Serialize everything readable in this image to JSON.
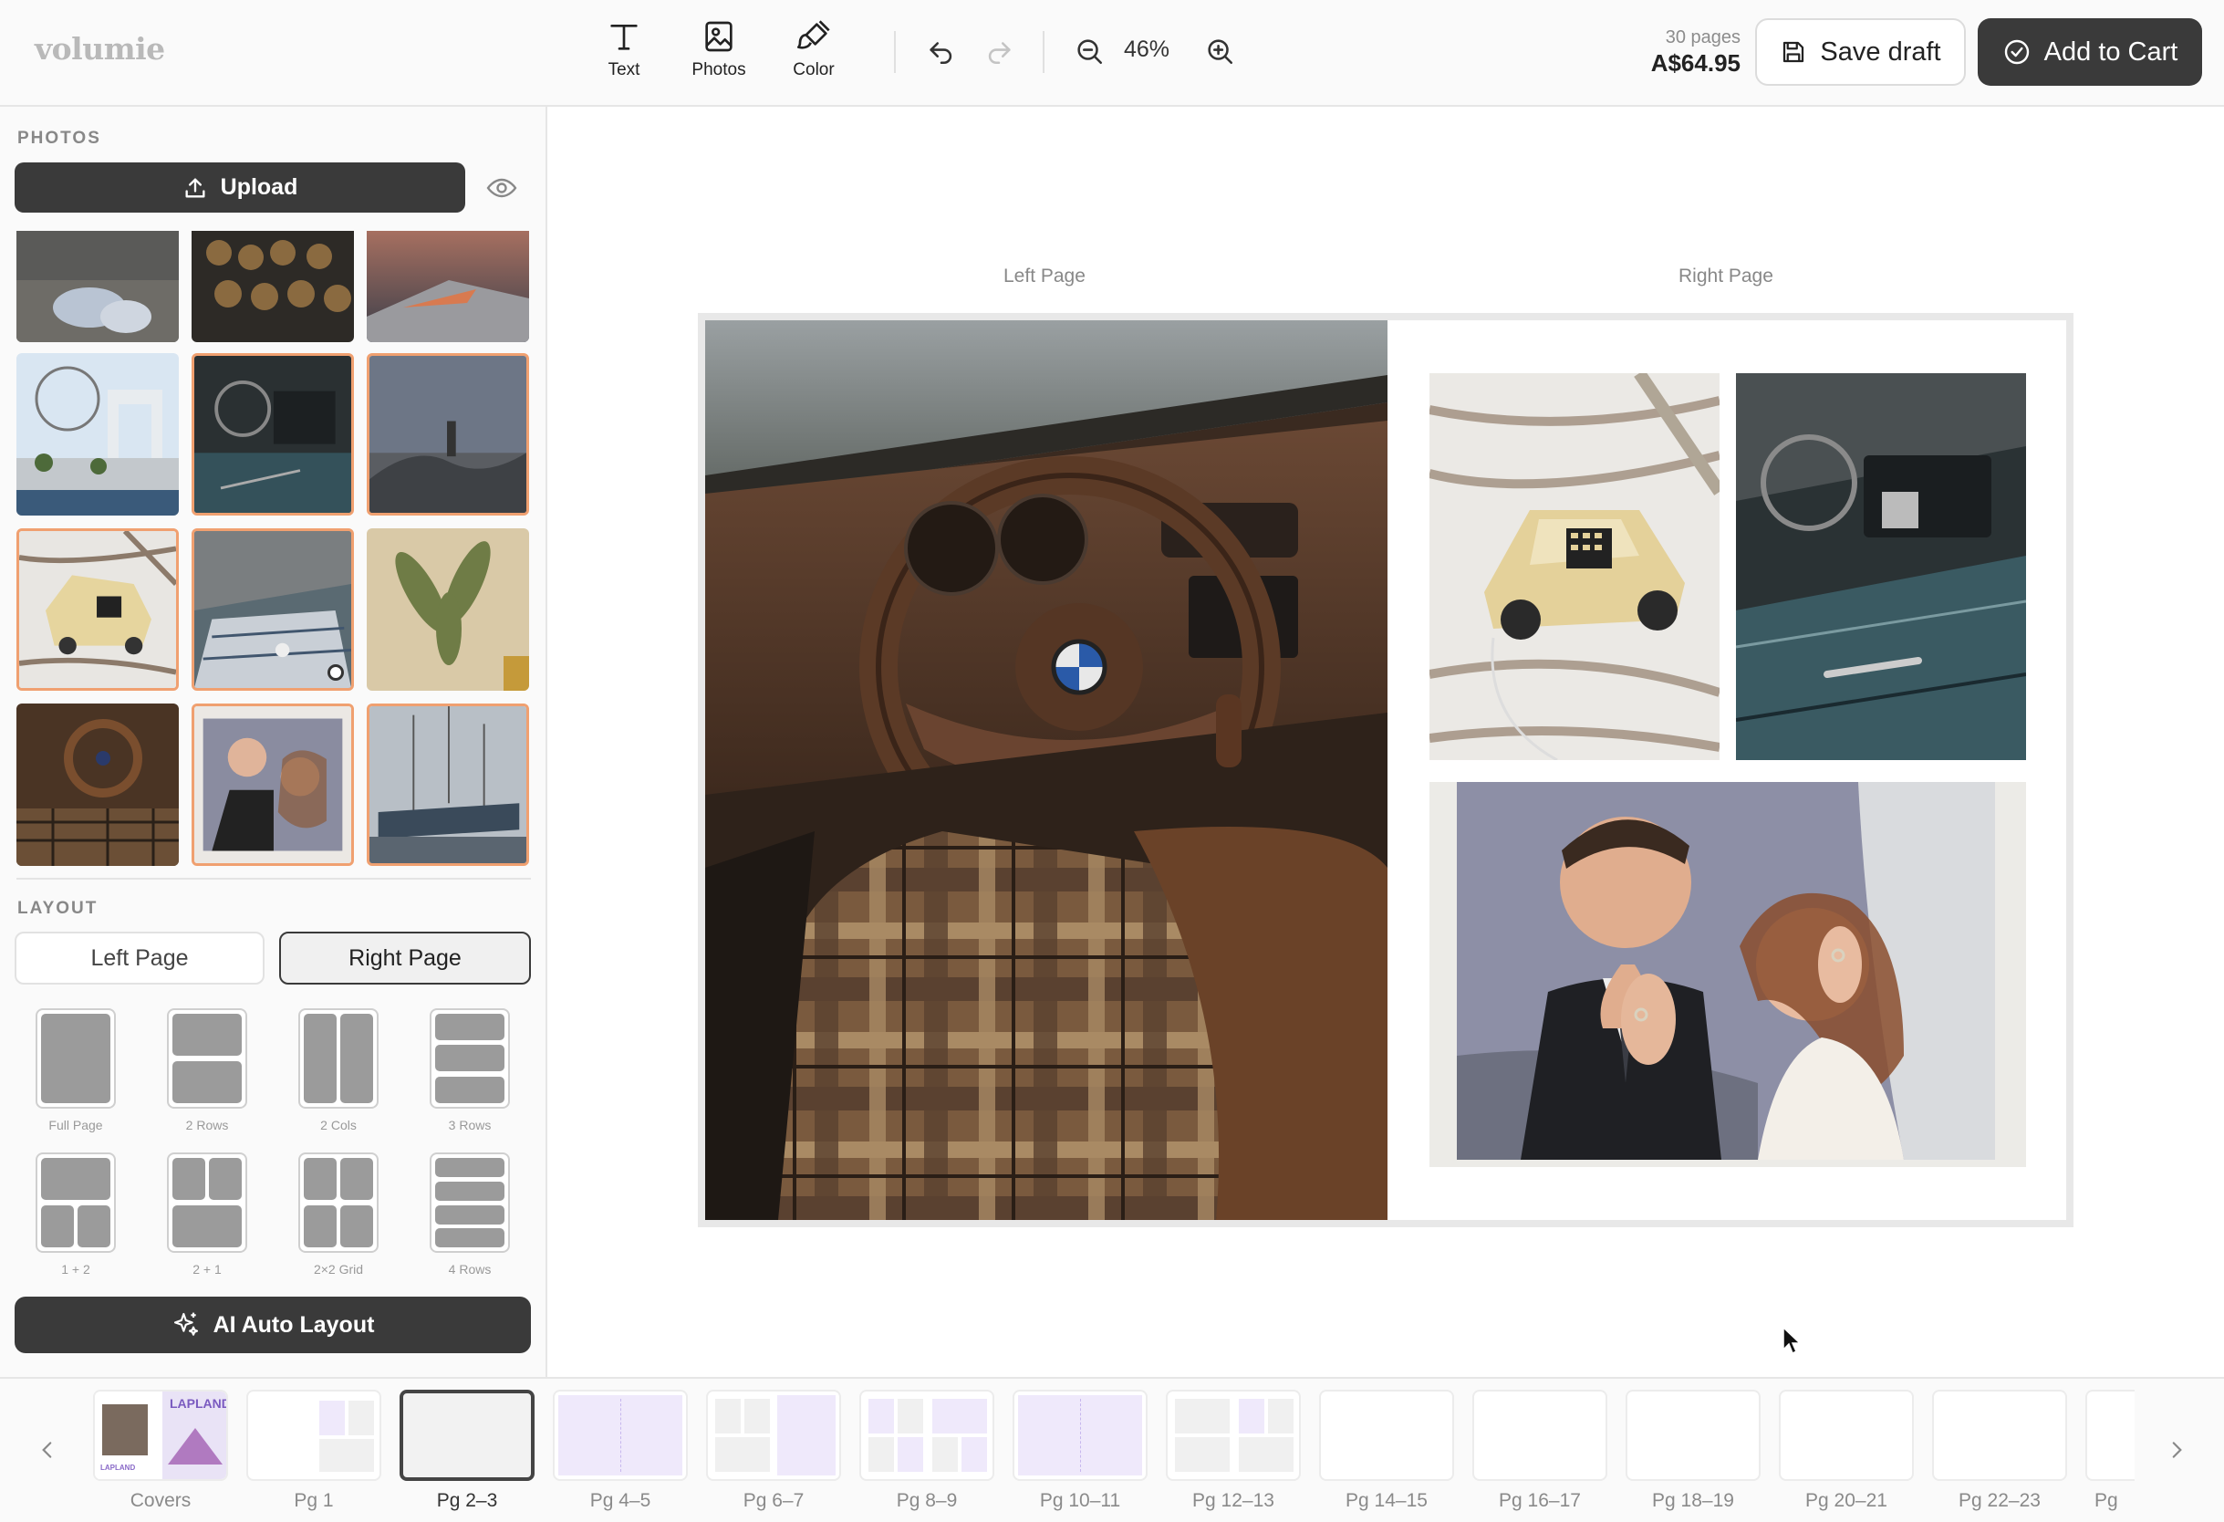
{
  "app": {
    "logo": "volumie"
  },
  "toolbar": {
    "text_label": "Text",
    "photos_label": "Photos",
    "color_label": "Color",
    "zoom": "46%",
    "pages_count": "30 pages",
    "price": "A$64.95",
    "save_label": "Save draft",
    "cart_label": "Add to Cart"
  },
  "sidebar": {
    "photos_title": "PHOTOS",
    "upload_label": "Upload",
    "layout_title": "LAYOUT",
    "left_page_label": "Left Page",
    "right_page_label": "Right Page",
    "selected_page": "Right Page",
    "layouts": [
      {
        "label": "Full Page"
      },
      {
        "label": "2 Rows"
      },
      {
        "label": "2 Cols"
      },
      {
        "label": "3 Rows"
      },
      {
        "label": "1 + 2"
      },
      {
        "label": "2 + 1"
      },
      {
        "label": "2×2 Grid"
      },
      {
        "label": "4 Rows"
      }
    ],
    "ai_label": "AI Auto Layout"
  },
  "canvas": {
    "left_page_label": "Left Page",
    "right_page_label": "Right Page"
  },
  "filmstrip": {
    "active": "Pg 2–3",
    "items": [
      {
        "label": "Covers"
      },
      {
        "label": "Pg 1"
      },
      {
        "label": "Pg 2–3"
      },
      {
        "label": "Pg 4–5"
      },
      {
        "label": "Pg 6–7"
      },
      {
        "label": "Pg 8–9"
      },
      {
        "label": "Pg 10–11"
      },
      {
        "label": "Pg 12–13"
      },
      {
        "label": "Pg 14–15"
      },
      {
        "label": "Pg 16–17"
      },
      {
        "label": "Pg 18–19"
      },
      {
        "label": "Pg 20–21"
      },
      {
        "label": "Pg 22–23"
      },
      {
        "label": "Pg"
      }
    ],
    "cover_thumb_text": "LAPLAND"
  },
  "colors": {
    "accent_dark": "#3a3a3a",
    "used_photo_border": "#f0a070",
    "lilac_layout": "#efe9fb"
  }
}
